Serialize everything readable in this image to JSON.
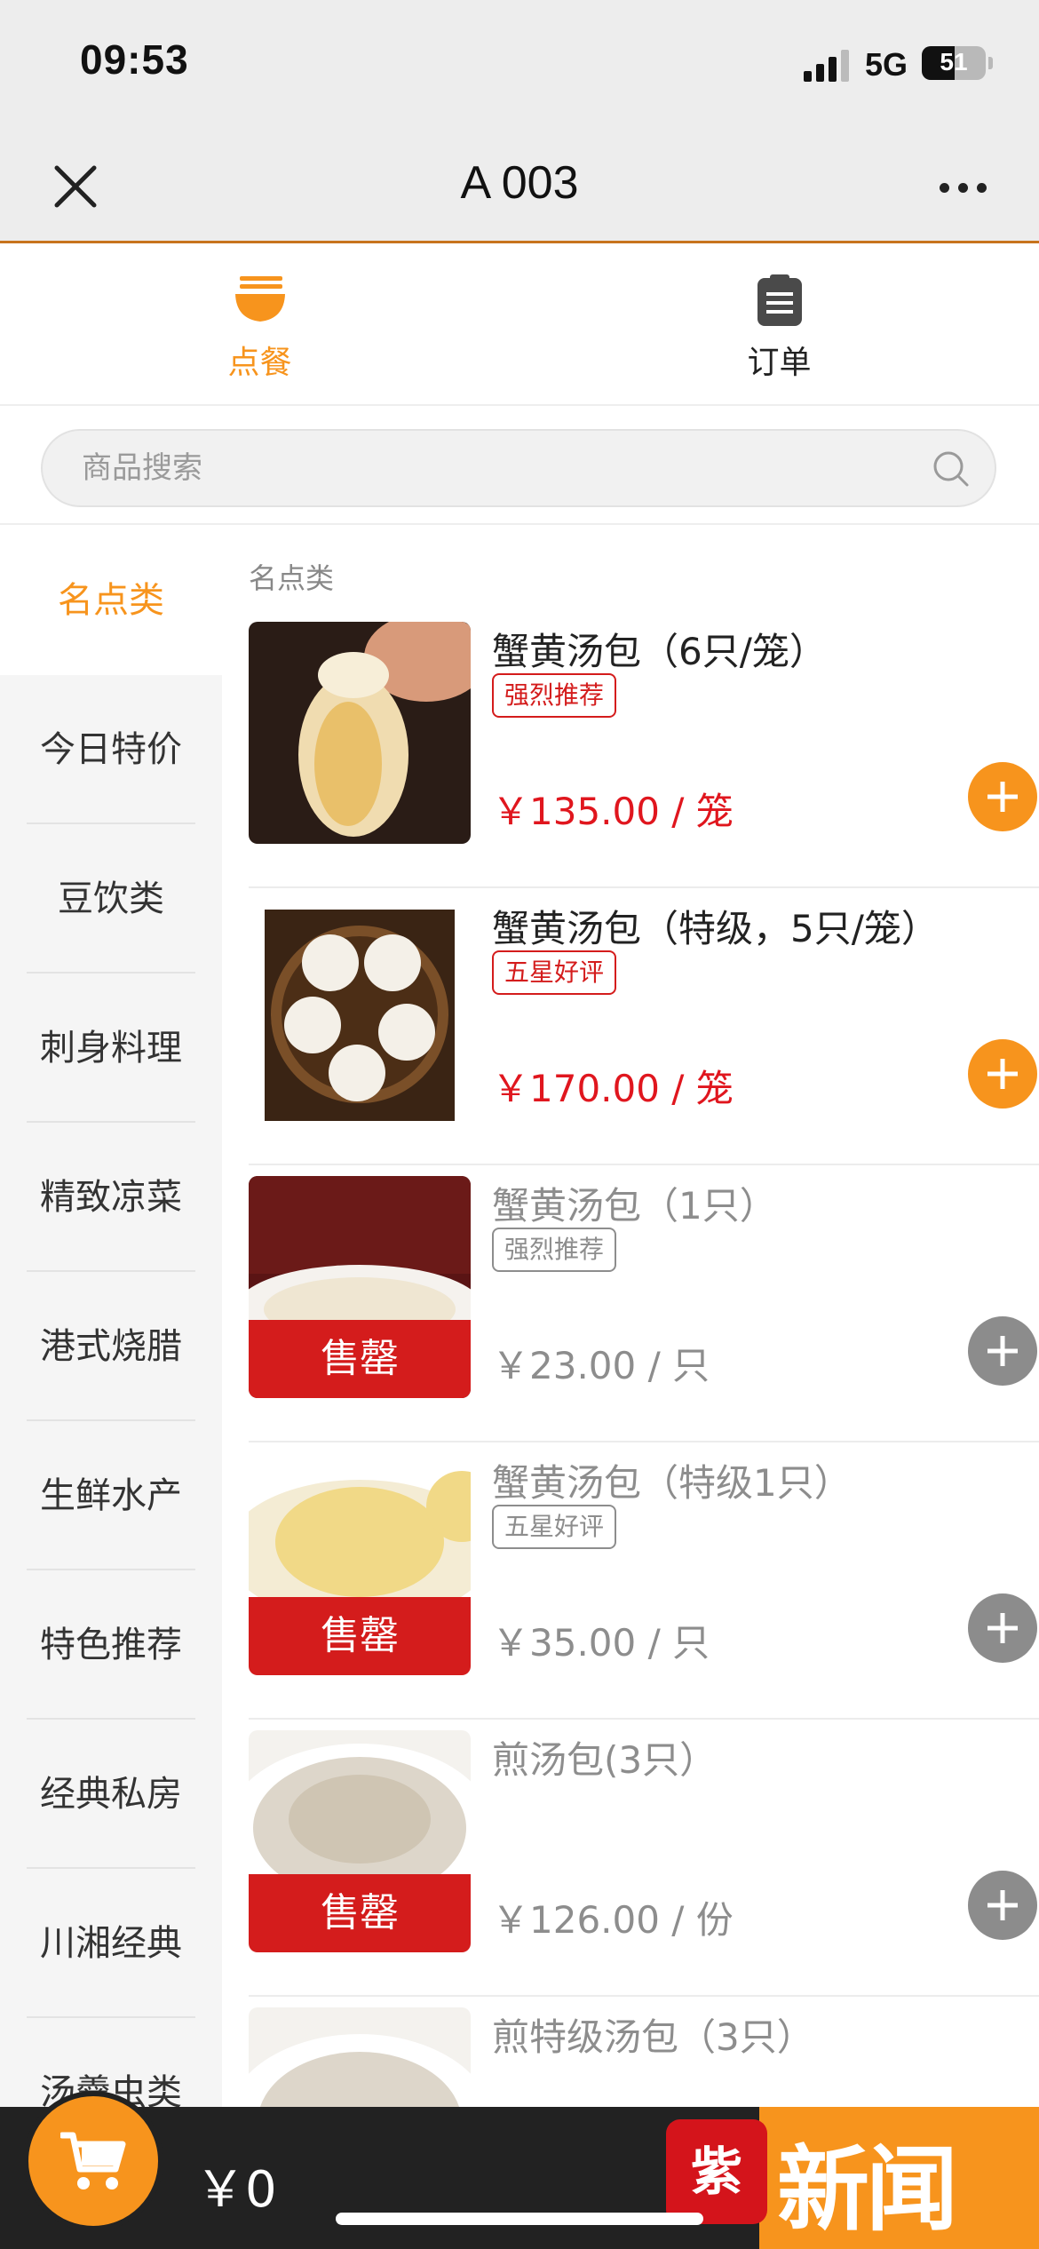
{
  "status": {
    "time": "09:53",
    "network": "5G",
    "battery": "51",
    "battery_level": 0.51
  },
  "nav": {
    "title": "A 003"
  },
  "tabs": [
    {
      "label": "点餐",
      "icon": "bowl-icon",
      "active": true
    },
    {
      "label": "订单",
      "icon": "clipboard-icon",
      "active": false
    }
  ],
  "search": {
    "placeholder": "商品搜索"
  },
  "sidebar": {
    "categories": [
      {
        "label": "名点类",
        "active": true
      },
      {
        "label": "今日特价"
      },
      {
        "label": "豆饮类"
      },
      {
        "label": "刺身料理"
      },
      {
        "label": "精致凉菜"
      },
      {
        "label": "港式烧腊"
      },
      {
        "label": "生鲜水产"
      },
      {
        "label": "特色推荐"
      },
      {
        "label": "经典私房"
      },
      {
        "label": "川湘经典"
      },
      {
        "label": "汤羹虫类"
      }
    ]
  },
  "content": {
    "section_title": "名点类",
    "items": [
      {
        "name": "蟹黄汤包（6只/笼）",
        "tag": "强烈推荐",
        "price": "￥135.00 / 笼",
        "sold_out": false
      },
      {
        "name": "蟹黄汤包（特级，5只/笼）",
        "tag": "五星好评",
        "price": "￥170.00 / 笼",
        "sold_out": false
      },
      {
        "name": "蟹黄汤包（1只）",
        "tag": "强烈推荐",
        "price": "￥23.00 / 只",
        "sold_out": true,
        "sold_label": "售罄"
      },
      {
        "name": "蟹黄汤包（特级1只）",
        "tag": "五星好评",
        "price": "￥35.00 / 只",
        "sold_out": true,
        "sold_label": "售罄"
      },
      {
        "name": "煎汤包(3只）",
        "tag": "",
        "price": "￥126.00 / 份",
        "sold_out": true,
        "sold_label": "售罄"
      },
      {
        "name": "煎特级汤包（3只）",
        "tag": "",
        "price": "",
        "sold_out": false
      }
    ]
  },
  "cart": {
    "total": "￥0"
  },
  "watermark": {
    "badge": "紫牛",
    "text": "新闻"
  },
  "colors": {
    "accent": "#f7941d",
    "price_red": "#e0161e",
    "soldout_red": "#d41c1c",
    "cart_bar": "#222222"
  }
}
